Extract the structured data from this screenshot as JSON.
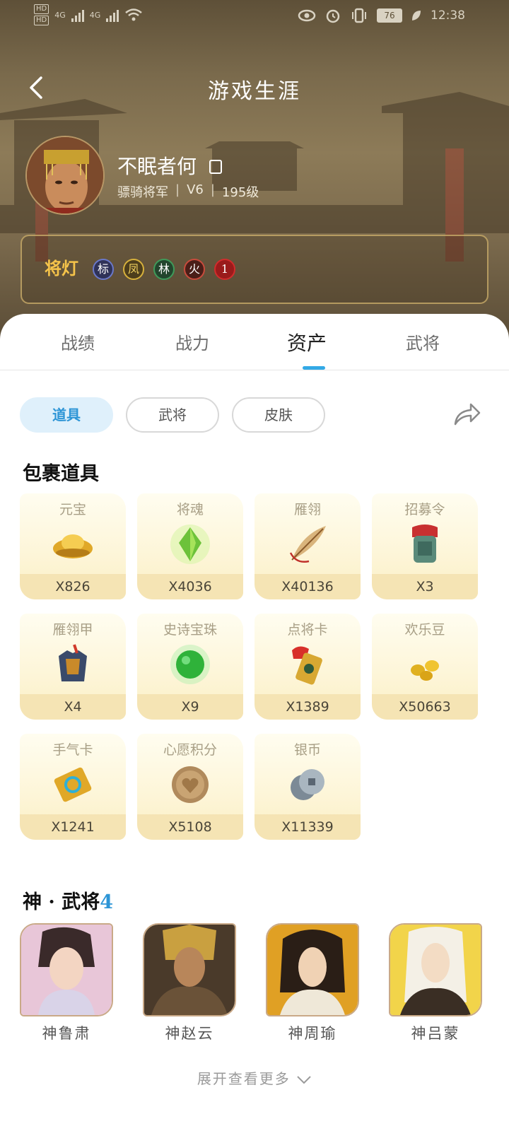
{
  "status_bar": {
    "net1": "4G",
    "net2": "4G",
    "hd": "HD",
    "battery": "76",
    "time": "12:38"
  },
  "header": {
    "title": "游戏生涯"
  },
  "player": {
    "name": "不眠者何",
    "rank": "骠骑将军",
    "vip": "V6",
    "level": "195级"
  },
  "lamp": {
    "label": "将灯",
    "badges": [
      {
        "char": "标",
        "color": "#6a78c9"
      },
      {
        "char": "凤",
        "color": "#d7b13c"
      },
      {
        "char": "林",
        "color": "#3f9a5a"
      },
      {
        "char": "火",
        "color": "#c84b3c"
      },
      {
        "char": "1",
        "color": "#d12c2c"
      }
    ]
  },
  "tabs": [
    "战绩",
    "战力",
    "资产",
    "武将"
  ],
  "active_tab": "资产",
  "chips": [
    "道具",
    "武将",
    "皮肤"
  ],
  "bag_section": {
    "title": "包裹道具"
  },
  "items": [
    {
      "name": "元宝",
      "qty": "X826",
      "icon": "gold-ingot-icon"
    },
    {
      "name": "将魂",
      "qty": "X4036",
      "icon": "green-crystal-icon"
    },
    {
      "name": "雁翎",
      "qty": "X40136",
      "icon": "feather-icon"
    },
    {
      "name": "招募令",
      "qty": "X3",
      "icon": "recruit-token-icon"
    },
    {
      "name": "雁翎甲",
      "qty": "X4",
      "icon": "armor-icon"
    },
    {
      "name": "史诗宝珠",
      "qty": "X9",
      "icon": "epic-orb-icon"
    },
    {
      "name": "点将卡",
      "qty": "X1389",
      "icon": "general-card-icon"
    },
    {
      "name": "欢乐豆",
      "qty": "X50663",
      "icon": "beans-icon"
    },
    {
      "name": "手气卡",
      "qty": "X1241",
      "icon": "luck-card-icon"
    },
    {
      "name": "心愿积分",
      "qty": "X5108",
      "icon": "heart-coin-icon"
    },
    {
      "name": "银币",
      "qty": "X11339",
      "icon": "silver-coin-icon"
    }
  ],
  "generals_section": {
    "title": "神 · 武将",
    "count": "4"
  },
  "generals": [
    "神鲁肃",
    "神赵云",
    "神周瑜",
    "神吕蒙"
  ],
  "expand_label": "展开查看更多"
}
